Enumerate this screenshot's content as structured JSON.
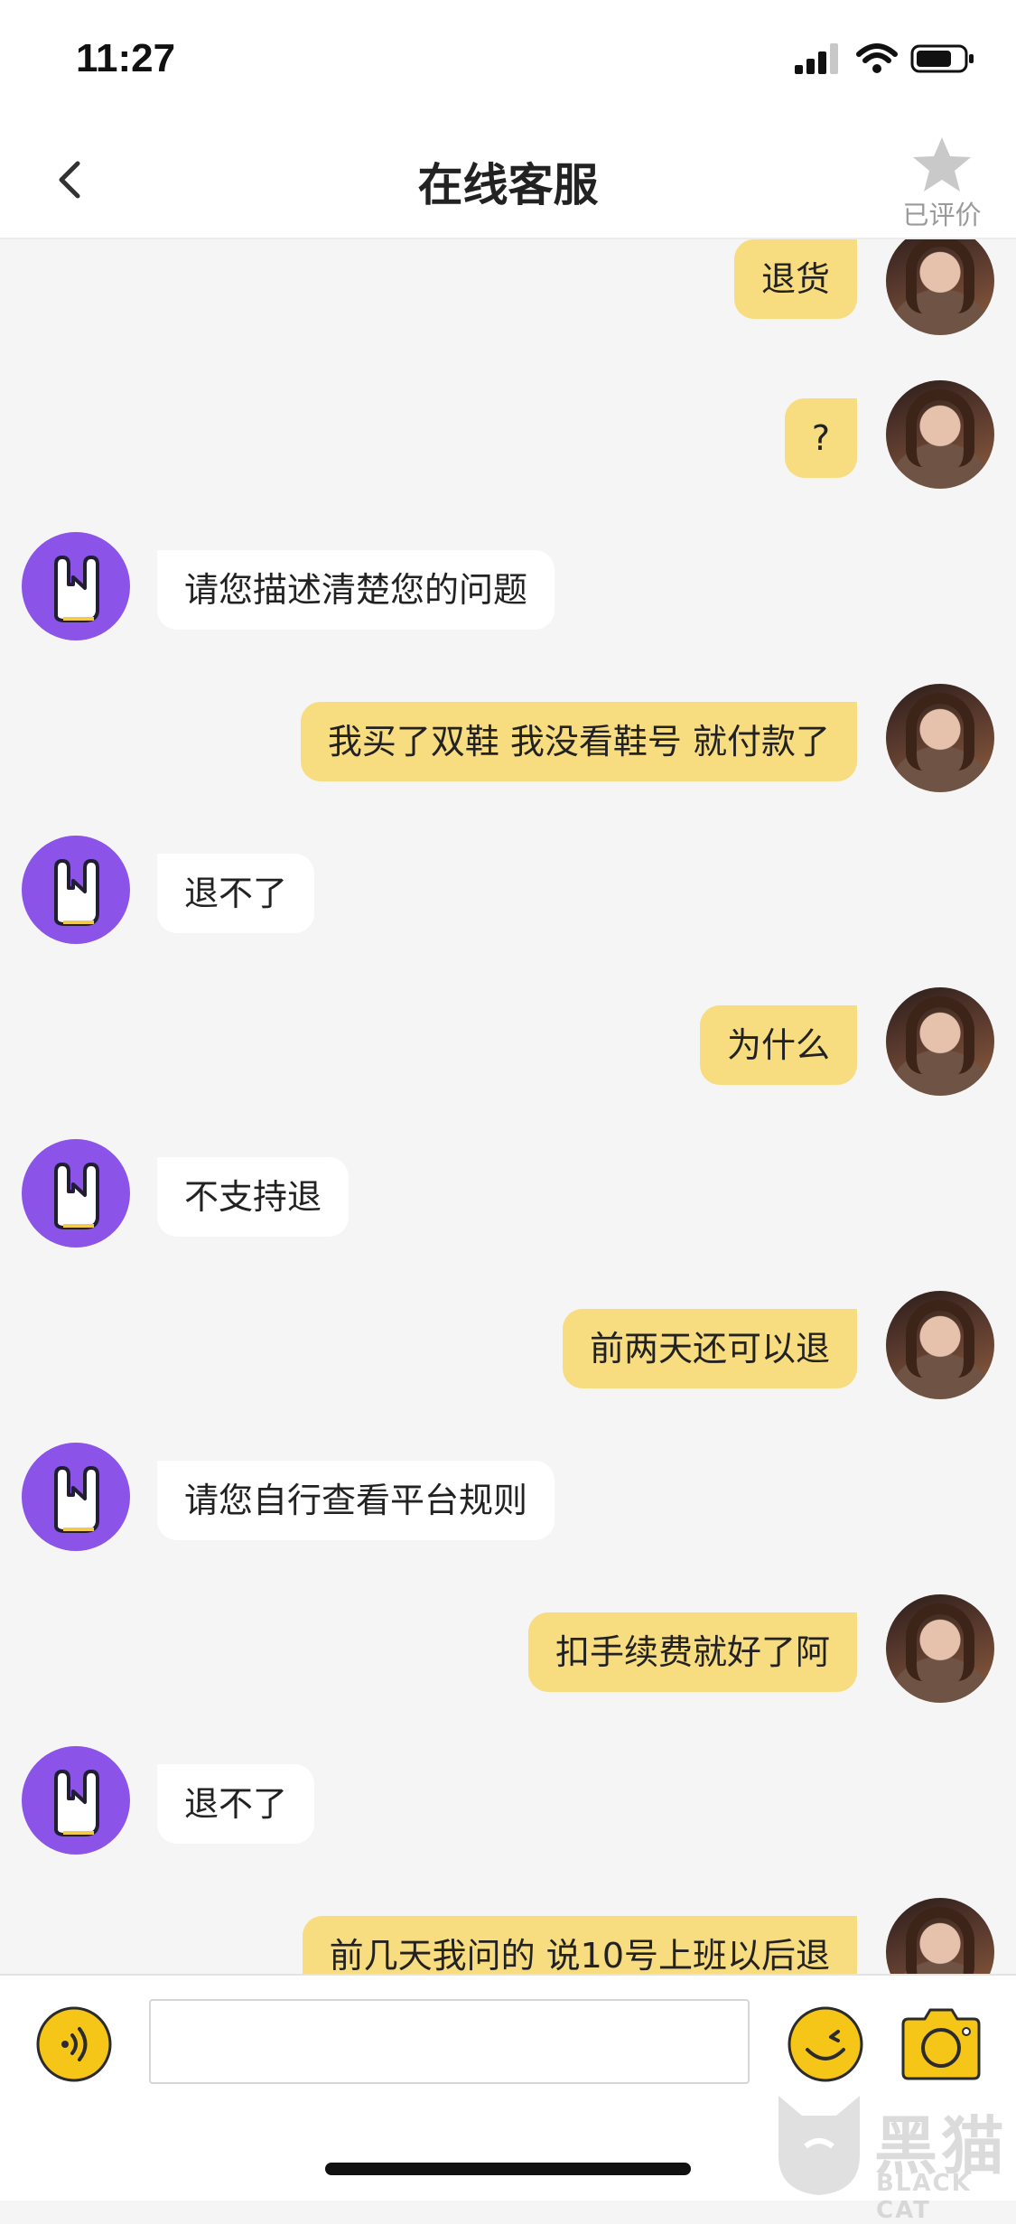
{
  "status_bar": {
    "time": "11:27"
  },
  "nav": {
    "title": "在线客服",
    "rate_label": "已评价"
  },
  "messages": [
    {
      "from": "user",
      "text": "退货"
    },
    {
      "from": "user",
      "text": "?"
    },
    {
      "from": "bot",
      "text": "请您描述清楚您的问题"
    },
    {
      "from": "user",
      "text": "我买了双鞋 我没看鞋号 就付款了"
    },
    {
      "from": "bot",
      "text": "退不了"
    },
    {
      "from": "user",
      "text": "为什么"
    },
    {
      "from": "bot",
      "text": "不支持退"
    },
    {
      "from": "user",
      "text": "前两天还可以退"
    },
    {
      "from": "bot",
      "text": "请您自行查看平台规则"
    },
    {
      "from": "user",
      "text": "扣手续费就好了阿"
    },
    {
      "from": "bot",
      "text": "退不了"
    },
    {
      "from": "user",
      "text": "前几天我问的 说10号上班以后退"
    }
  ],
  "input_bar": {
    "value": ""
  },
  "watermark": {
    "cn": "黑猫",
    "en": "BLACK CAT"
  },
  "colors": {
    "user_bubble": "#f8dc80",
    "bot_bubble": "#ffffff",
    "accent": "#f5c518",
    "bot_avatar": "#8b53e8"
  }
}
